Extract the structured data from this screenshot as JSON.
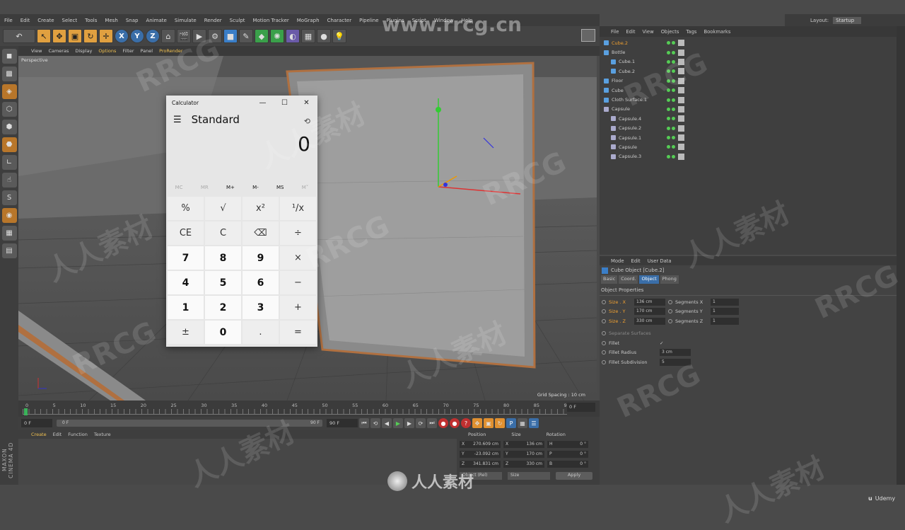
{
  "menubar": [
    "File",
    "Edit",
    "Create",
    "Select",
    "Tools",
    "Mesh",
    "Snap",
    "Animate",
    "Simulate",
    "Render",
    "Sculpt",
    "Motion Tracker",
    "MoGraph",
    "Character",
    "Pipeline",
    "Plugins",
    "Script",
    "Window",
    "Help"
  ],
  "layout": {
    "label": "Layout:",
    "value": "Startup"
  },
  "viewport_menu": [
    "View",
    "Cameras",
    "Display",
    "Options",
    "Filter",
    "Panel",
    "ProRender"
  ],
  "viewport": {
    "label": "Perspective",
    "grid_spacing": "Grid Spacing : 10 cm"
  },
  "timeline": {
    "ticks": [
      "0",
      "5",
      "10",
      "15",
      "20",
      "25",
      "30",
      "35",
      "40",
      "45",
      "50",
      "55",
      "60",
      "65",
      "70",
      "75",
      "80",
      "85",
      "90"
    ],
    "end_frame": "0 F"
  },
  "playbar": {
    "start": "0 F",
    "slider_left": "0 F",
    "slider_right": "90 F",
    "end": "90 F"
  },
  "bottom_menu": [
    "Create",
    "Edit",
    "Function",
    "Texture"
  ],
  "coords": {
    "headers": [
      "Position",
      "Size",
      "Rotation"
    ],
    "rows": [
      {
        "axis": "X",
        "pos": "270.609 cm",
        "saxis": "X",
        "size": "136 cm",
        "raxis": "H",
        "rot": "0 °"
      },
      {
        "axis": "Y",
        "pos": "-23.092 cm",
        "saxis": "Y",
        "size": "170 cm",
        "raxis": "P",
        "rot": "0 °"
      },
      {
        "axis": "Z",
        "pos": "341.831 cm",
        "saxis": "Z",
        "size": "330 cm",
        "raxis": "B",
        "rot": "0 °"
      }
    ],
    "mode": "Object (Rel)",
    "size_mode": "Size",
    "apply": "Apply"
  },
  "maxon": "MAXON CINEMA 4D",
  "object_manager": {
    "menu": [
      "File",
      "Edit",
      "View",
      "Objects",
      "Tags",
      "Bookmarks"
    ],
    "items": [
      {
        "name": "Cube.2",
        "indent": 0,
        "selected": true
      },
      {
        "name": "Bottle",
        "indent": 0,
        "selected": false
      },
      {
        "name": "Cube.1",
        "indent": 1,
        "selected": false
      },
      {
        "name": "Cube.2",
        "indent": 1,
        "selected": false
      },
      {
        "name": "Floor",
        "indent": 0,
        "selected": false
      },
      {
        "name": "Cube",
        "indent": 0,
        "selected": false
      },
      {
        "name": "Cloth Surface.1",
        "indent": 0,
        "selected": false
      },
      {
        "name": "Capsule",
        "indent": 0,
        "selected": false
      },
      {
        "name": "Capsule.4",
        "indent": 1,
        "selected": false
      },
      {
        "name": "Capsule.2",
        "indent": 1,
        "selected": false
      },
      {
        "name": "Capsule.1",
        "indent": 1,
        "selected": false
      },
      {
        "name": "Capsule",
        "indent": 1,
        "selected": false
      },
      {
        "name": "Capsule.3",
        "indent": 1,
        "selected": false
      }
    ]
  },
  "attribute_manager": {
    "menu": [
      "Mode",
      "Edit",
      "User Data"
    ],
    "title": "Cube Object [Cube.2]",
    "tabs": [
      "Basic",
      "Coord.",
      "Object",
      "Phong"
    ],
    "active_tab": "Object",
    "section": "Object Properties",
    "sizes": [
      {
        "label": "Size . X",
        "value": "136 cm",
        "seg_label": "Segments X",
        "seg_value": "1"
      },
      {
        "label": "Size . Y",
        "value": "170 cm",
        "seg_label": "Segments Y",
        "seg_value": "1"
      },
      {
        "label": "Size . Z",
        "value": "330 cm",
        "seg_label": "Segments Z",
        "seg_value": "1"
      }
    ],
    "separate_surfaces": "Separate Surfaces",
    "fillet": "Fillet",
    "fillet_check": "✓",
    "fillet_radius": {
      "label": "Fillet Radius",
      "value": "3 cm"
    },
    "fillet_subdivision": {
      "label": "Fillet Subdivision",
      "value": "5"
    }
  },
  "calculator": {
    "title": "Calculator",
    "mode": "Standard",
    "display": "0",
    "memory": [
      "MC",
      "MR",
      "M+",
      "M-",
      "MS",
      "M˅"
    ],
    "keys": [
      "%",
      "√",
      "x²",
      "¹/x",
      "CE",
      "C",
      "⌫",
      "÷",
      "7",
      "8",
      "9",
      "×",
      "4",
      "5",
      "6",
      "−",
      "1",
      "2",
      "3",
      "+",
      "±",
      "0",
      ".",
      "="
    ]
  },
  "watermarks": {
    "rrcg": "RRCG",
    "cn": "人人素材",
    "site": "www.rrcg.cn"
  },
  "udemy": "Udemy"
}
